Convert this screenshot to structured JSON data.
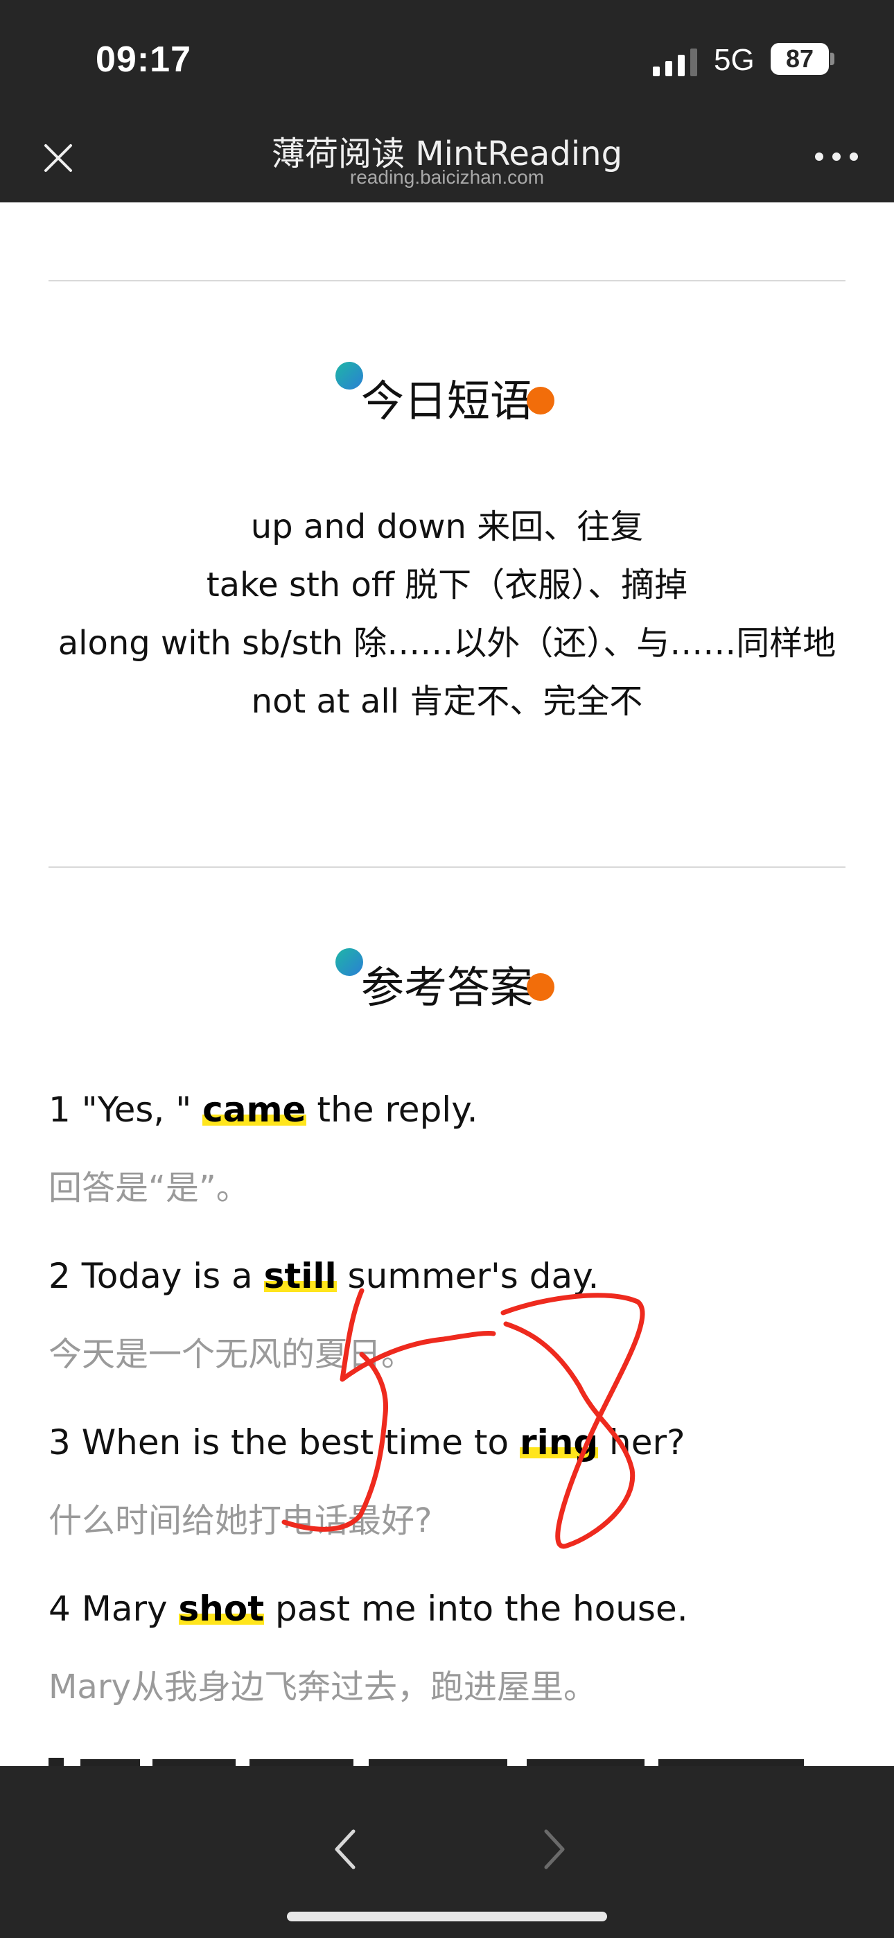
{
  "status_bar": {
    "time": "09:17",
    "network": "5G",
    "battery": "87"
  },
  "nav": {
    "title": "薄荷阅读 MintReading",
    "subtitle": "reading.baicizhan.com",
    "icons": {
      "close": "close-icon",
      "more": "more-icon"
    }
  },
  "phrases_section": {
    "title": "今日短语",
    "items": [
      "up and down 来回、往复",
      "take sth off 脱下（衣服）、摘掉",
      "along with sb/sth 除……以外（还）、与……同样地",
      "not at all 肯定不、完全不"
    ]
  },
  "answers_section": {
    "title": "参考答案",
    "items": [
      {
        "before": "1 \"Yes, \" ",
        "word": "came",
        "after": " the reply.",
        "translation": "回答是“是”。"
      },
      {
        "before": "2 Today is a ",
        "word": "still",
        "after": " summer's day.",
        "translation": "今天是一个无风的夏日。"
      },
      {
        "before": "3 When is the best time to ",
        "word": "ring",
        "after": " her?",
        "translation": "什么时间给她打电话最好?"
      },
      {
        "before": "4 Mary ",
        "word": "shot",
        "after": " past me into the house.",
        "translation": "Mary从我身边飞奔过去，跑进屋里。"
      }
    ]
  },
  "toolbar": {
    "icons": {
      "back": "chevron-left-icon",
      "forward": "chevron-right-icon"
    }
  },
  "colors": {
    "bar_bg": "#262626",
    "highlight": "#ffe51c",
    "scribble": "#ee2a1e",
    "dot_orange": "#f26d0a",
    "dot_teal": "#1fb6a6"
  }
}
